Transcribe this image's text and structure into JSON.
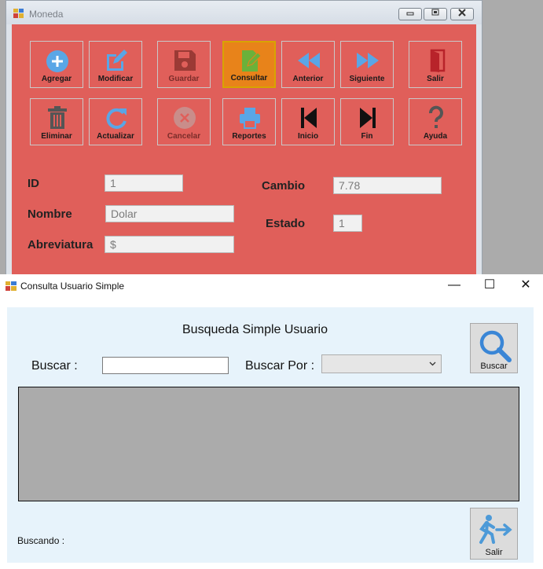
{
  "moneda_window": {
    "title": "Moneda",
    "toolbar_row1": [
      {
        "label": "Agregar",
        "icon": "add-icon"
      },
      {
        "label": "Modificar",
        "icon": "edit-icon"
      },
      {
        "label": "Guardar",
        "icon": "save-icon"
      },
      {
        "label": "Consultar",
        "icon": "query-icon"
      },
      {
        "label": "Anterior",
        "icon": "previous-icon"
      },
      {
        "label": "Siguiente",
        "icon": "next-icon"
      },
      {
        "label": "Salir",
        "icon": "exit-door-icon"
      }
    ],
    "toolbar_row2": [
      {
        "label": "Eliminar",
        "icon": "trash-icon"
      },
      {
        "label": "Actualizar",
        "icon": "refresh-icon"
      },
      {
        "label": "Cancelar",
        "icon": "cancel-icon"
      },
      {
        "label": "Reportes",
        "icon": "printer-icon"
      },
      {
        "label": "Inicio",
        "icon": "first-icon"
      },
      {
        "label": "Fin",
        "icon": "last-icon"
      },
      {
        "label": "Ayuda",
        "icon": "help-icon"
      }
    ],
    "fields": {
      "id_label": "ID",
      "id_value": "1",
      "nombre_label": "Nombre",
      "nombre_value": "Dolar",
      "abreviatura_label": "Abreviatura",
      "abreviatura_value": "$",
      "cambio_label": "Cambio",
      "cambio_value": "7.78",
      "estado_label": "Estado",
      "estado_value": "1"
    },
    "colors": {
      "client_bg": "#e05f5a",
      "active_button": "#e8831a"
    }
  },
  "consulta_window": {
    "title": "Consulta Usuario Simple",
    "minimize": "—",
    "maximize": "☐",
    "close": "✕",
    "heading": "Busqueda Simple Usuario",
    "buscar_label": "Buscar :",
    "buscar_value": "",
    "buscar_por_label": "Buscar Por :",
    "buscar_por_value": "",
    "search_button_label": "Buscar",
    "exit_button_label": "Salir",
    "status_label": "Buscando :",
    "colors": {
      "client_bg": "#e7f3fb",
      "grid_bg": "#ababab"
    }
  }
}
